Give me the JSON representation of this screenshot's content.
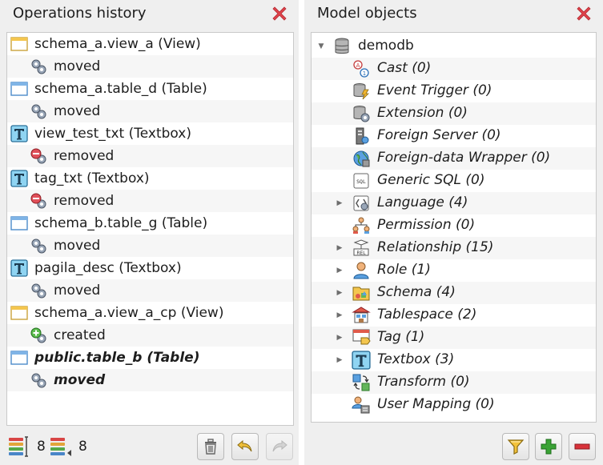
{
  "left_panel": {
    "title": "Operations history",
    "entries": [
      {
        "object": "schema_a.view_a (View)",
        "object_icon": "view-icon",
        "operation": "moved",
        "op_icon": "moved-icon"
      },
      {
        "object": "schema_a.table_d (Table)",
        "object_icon": "table-icon",
        "operation": "moved",
        "op_icon": "moved-icon"
      },
      {
        "object": "view_test_txt (Textbox)",
        "object_icon": "textbox-icon",
        "operation": "removed",
        "op_icon": "removed-icon"
      },
      {
        "object": "tag_txt (Textbox)",
        "object_icon": "textbox-icon",
        "operation": "removed",
        "op_icon": "removed-icon"
      },
      {
        "object": "schema_b.table_g (Table)",
        "object_icon": "table-icon",
        "operation": "moved",
        "op_icon": "moved-icon"
      },
      {
        "object": "pagila_desc (Textbox)",
        "object_icon": "textbox-icon",
        "operation": "moved",
        "op_icon": "moved-icon"
      },
      {
        "object": "schema_a.view_a_cp (View)",
        "object_icon": "view-icon",
        "operation": "created",
        "op_icon": "created-icon"
      },
      {
        "object": "public.table_b (Table)",
        "object_icon": "table-icon",
        "operation": "moved",
        "op_icon": "moved-icon"
      }
    ],
    "footer": {
      "position_count": "8",
      "total_count": "8",
      "buttons": [
        "trash-icon",
        "undo-icon",
        "redo-icon"
      ]
    }
  },
  "right_panel": {
    "title": "Model objects",
    "root": {
      "label": "demodb",
      "icon": "database-icon"
    },
    "children": [
      {
        "label": "Cast (0)",
        "icon": "cast-icon",
        "expandable": false
      },
      {
        "label": "Event Trigger (0)",
        "icon": "event-trigger-icon",
        "expandable": false
      },
      {
        "label": "Extension (0)",
        "icon": "extension-icon",
        "expandable": false
      },
      {
        "label": "Foreign Server (0)",
        "icon": "foreign-server-icon",
        "expandable": false
      },
      {
        "label": "Foreign-data Wrapper (0)",
        "icon": "foreign-data-wrapper-icon",
        "expandable": false
      },
      {
        "label": "Generic SQL (0)",
        "icon": "generic-sql-icon",
        "expandable": false
      },
      {
        "label": "Language (4)",
        "icon": "language-icon",
        "expandable": true
      },
      {
        "label": "Permission (0)",
        "icon": "permission-icon",
        "expandable": false
      },
      {
        "label": "Relationship (15)",
        "icon": "relationship-icon",
        "expandable": true
      },
      {
        "label": "Role (1)",
        "icon": "role-icon",
        "expandable": true
      },
      {
        "label": "Schema (4)",
        "icon": "schema-icon",
        "expandable": true
      },
      {
        "label": "Tablespace (2)",
        "icon": "tablespace-icon",
        "expandable": true
      },
      {
        "label": "Tag (1)",
        "icon": "tag-icon",
        "expandable": true
      },
      {
        "label": "Textbox (3)",
        "icon": "textbox-icon",
        "expandable": true
      },
      {
        "label": "Transform (0)",
        "icon": "transform-icon",
        "expandable": false
      },
      {
        "label": "User Mapping (0)",
        "icon": "user-mapping-icon",
        "expandable": false
      }
    ],
    "footer": {
      "buttons": [
        "filter-icon",
        "add-icon",
        "remove-icon"
      ]
    }
  },
  "colors": {
    "panel_bg": "#efefef",
    "close_red": "#e0434b",
    "add_green": "#3aa335",
    "remove_red": "#d8323a"
  }
}
